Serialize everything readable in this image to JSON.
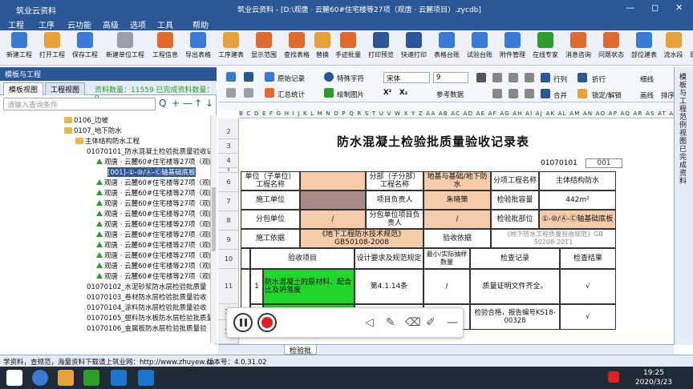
{
  "window": {
    "app_name": "筑业云资料",
    "title": "筑业云资料 - [D:\\观唐 · 云麓60#住宅楼等27项（观唐 · 云麓项目）.zycdb]",
    "min": "—",
    "max": "◻",
    "close": "✕"
  },
  "menu": [
    "工程",
    "工序",
    "云功能",
    "高级",
    "选项",
    "工具",
    "帮助"
  ],
  "ribbon": [
    {
      "label": "新建工程",
      "color": "#3a7bd5"
    },
    {
      "label": "打开工程",
      "color": "#e8a23a"
    },
    {
      "label": "保存工程",
      "color": "#3a7bd5"
    },
    {
      "label": "新建单位工程",
      "color": "#9aa0a8"
    },
    {
      "label": "工程信息",
      "color": "#e06b2d"
    },
    {
      "label": "导出表格",
      "color": "#3a7bd5"
    },
    {
      "label": "工序建表",
      "color": "#e8a23a"
    },
    {
      "label": "显示范围",
      "color": "#e06b2d"
    },
    {
      "label": "查找表格",
      "color": "#e06b2d"
    },
    {
      "label": "替换",
      "color": "#e8a23a"
    },
    {
      "label": "手迹批量",
      "color": "#e06b2d"
    },
    {
      "label": "打印预览",
      "color": "#2b5797"
    },
    {
      "label": "快速打印",
      "color": "#2b5797"
    },
    {
      "label": "表格台账",
      "color": "#3a7bd5"
    },
    {
      "label": "试验台账",
      "color": "#3a7bd5"
    },
    {
      "label": "附件管理",
      "color": "#3a7bd5"
    },
    {
      "label": "在线专家",
      "color": "#2b9d2b"
    },
    {
      "label": "消息咨询",
      "color": "#e06b2d"
    },
    {
      "label": "问题状态",
      "color": "#e06b2d"
    },
    {
      "label": "部位建表",
      "color": "#3a7bd5"
    },
    {
      "label": "流水段",
      "color": "#e8a23a"
    },
    {
      "label": "目录管理",
      "color": "#3a7bd5"
    }
  ],
  "left": {
    "header": "模板与工程",
    "tabs": [
      "模板视图",
      "工程视图"
    ],
    "count_text": "资料数量：11559  已完成资料数量：0",
    "search_placeholder": "请输入查询条件",
    "tools": [
      "Q",
      "+",
      "—",
      "↑",
      "↓"
    ],
    "tree": [
      {
        "text": "0106_边坡",
        "indent": 80,
        "type": "folder",
        "sel": false
      },
      {
        "text": "0107_地下防水",
        "indent": 80,
        "type": "folder",
        "sel": false
      },
      {
        "text": "主体结构防水工程",
        "indent": 94,
        "type": "folder",
        "sel": false
      },
      {
        "text": "01070101_防水混凝土检验批质量验收记",
        "indent": 108,
        "type": "text",
        "sel": false
      },
      {
        "text": "观唐 · 云麓60#住宅楼等27项（观唐",
        "indent": 120,
        "type": "tree",
        "sel": false
      },
      {
        "text": "[001]-①-⑩/Ⓐ-Ⓒ轴基础底板",
        "indent": 134,
        "type": "text",
        "sel": true
      },
      {
        "text": "观唐 · 云麓60#住宅楼等27项（观唐",
        "indent": 120,
        "type": "tree",
        "sel": false
      },
      {
        "text": "观唐 · 云麓60#住宅楼等27项（观唐",
        "indent": 120,
        "type": "tree",
        "sel": false
      },
      {
        "text": "观唐 · 云麓60#住宅楼等27项（观唐",
        "indent": 120,
        "type": "tree",
        "sel": false
      },
      {
        "text": "观唐 · 云麓60#住宅楼等27项（观唐",
        "indent": 120,
        "type": "tree",
        "sel": false
      },
      {
        "text": "观唐 · 云麓60#住宅楼等27项（观唐",
        "indent": 120,
        "type": "tree",
        "sel": false
      },
      {
        "text": "观唐 · 云麓60#住宅楼等27项（观唐",
        "indent": 120,
        "type": "tree",
        "sel": false
      },
      {
        "text": "观唐 · 云麓60#住宅楼等27项（观唐",
        "indent": 120,
        "type": "tree",
        "sel": false
      },
      {
        "text": "观唐 · 云麓60#住宅楼等27项（观唐",
        "indent": 120,
        "type": "tree",
        "sel": false
      },
      {
        "text": "观唐 · 云麓60#住宅楼等27项（观唐",
        "indent": 120,
        "type": "tree",
        "sel": false
      },
      {
        "text": "观唐 · 云麓60#住宅楼等27项（观唐",
        "indent": 120,
        "type": "tree",
        "sel": false
      },
      {
        "text": "01070102_水泥砂浆防水层检验批质量",
        "indent": 108,
        "type": "text",
        "sel": false
      },
      {
        "text": "01070103_卷材防水层检验批质量验收",
        "indent": 108,
        "type": "text",
        "sel": false
      },
      {
        "text": "01070104_涂料防水层检验批质量验收",
        "indent": 108,
        "type": "text",
        "sel": false
      },
      {
        "text": "01070105_塑料防水板防水层检验批质量",
        "indent": 108,
        "type": "text",
        "sel": false
      },
      {
        "text": "01070106_金属板防水层检验批质量验",
        "indent": 108,
        "type": "text",
        "sel": false
      }
    ]
  },
  "toolbar2": {
    "orig_record": "原始记录",
    "special_char": "特殊字符",
    "font": "宋体",
    "size": "9",
    "row_col": "行列",
    "wrap": "折行",
    "line_width": "细线",
    "summary": "汇总统计",
    "draw_image": "绘制图片",
    "ref_format": "参考数据",
    "merge": "合并",
    "lock": "锁定/解锁",
    "border": "画线",
    "sort": "排序",
    "x2": "X²",
    "x_2": "X₂"
  },
  "side": [
    "模板与工程",
    "范例视图",
    "已完成资料"
  ],
  "colhead": "B C D E F G H I J K L M N O P Q R S T U V W X Y Z AA AB AC AD AE AF AG AH AI AJ AK AL AM AN AO AP AQ AR AS AT AU",
  "rows": [
    "2",
    "3",
    "4",
    "5",
    "6",
    "7",
    "8",
    "9",
    "10",
    "11",
    "12",
    "13"
  ],
  "sheet": {
    "title": "防水混凝土检验批质量验收记录表",
    "code1": "01070101",
    "code2": "001",
    "labels": {
      "unit": "单位（子单位）工程名称",
      "subunit": "分部（子分部）工程名称",
      "basement": "地基与基础/地下防水",
      "subitem": "分项工程名称",
      "subitem_val": "主体结构防水",
      "builder": "施工单位",
      "pm": "项目负责人",
      "pm_val": "朱晓策",
      "capacity": "检验批容量",
      "capacity_val": "442m²",
      "sub_builder": "分包单位",
      "slash1": "/",
      "sub_pm": "分包单位项目负责人",
      "slash2": "/",
      "location": "检验批部位",
      "location_val": "①-⑩/Ⓐ-Ⓒ轴基础底板",
      "basis": "施工依据",
      "basis_val": "《地下工程防水技术规范》GB50108-2008",
      "accept": "验收依据",
      "accept_val": "《地下防水工程质量验收规范》GB 50208-2011",
      "h_item": "验收项目",
      "h_req": "设计要求及规范规定",
      "h_sample": "最小/实际抽样数量",
      "h_record": "检查记录",
      "h_result": "检查结果",
      "r1_no": "1",
      "r1_item": "防水混凝土的原材料、配合比及坍落度",
      "r1_req": "第4.1.14条",
      "r1_sample": "/",
      "r1_record": "质量证明文件齐全。",
      "r1_result": "√",
      "r2_no": "1",
      "r2_record": "检验合格，报告编号KS18-00328",
      "r2_result": "√"
    }
  },
  "tab_label": "检验批",
  "status": {
    "left": "学资料，查规范，海量资料下载请上筑业网：http://www.zhuyew.cn",
    "version": "版本号：4.0.31.02"
  },
  "clock": {
    "time": "19:25",
    "date": "2020/3/23"
  },
  "float_icons": [
    "pause-icon",
    "stop-icon",
    "mute-icon",
    "pen-icon",
    "eraser-icon",
    "highlighter-icon",
    "minimize-icon"
  ]
}
